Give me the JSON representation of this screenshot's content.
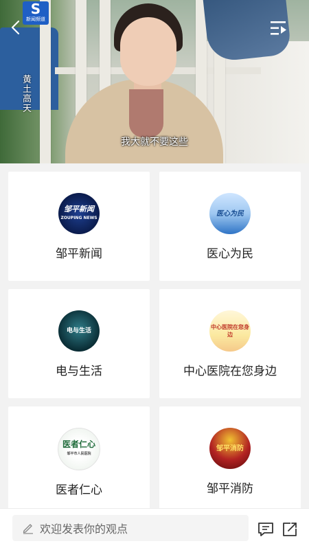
{
  "video": {
    "logo_letter": "S",
    "logo_caption": "新闻频道",
    "show_watermark": "黄土高天",
    "subtitle": "我大就不要这些"
  },
  "cards": [
    {
      "title": "邹平新闻",
      "avatar_text": "邹平新闻",
      "avatar_sub": "ZOUPING NEWS"
    },
    {
      "title": "医心为民",
      "avatar_text": "医心为民",
      "avatar_sub": ""
    },
    {
      "title": "电与生活",
      "avatar_text": "电与生活",
      "avatar_sub": ""
    },
    {
      "title": "中心医院在您身边",
      "avatar_text": "中心医院在您身边",
      "avatar_sub": ""
    },
    {
      "title": "医者仁心",
      "avatar_text": "医者仁心",
      "avatar_sub": "邹平市人民医院"
    },
    {
      "title": "邹平消防",
      "avatar_text": "邹平消防",
      "avatar_sub": ""
    }
  ],
  "bottom_bar": {
    "comment_placeholder": "欢迎发表你的观点",
    "icons": [
      "pencil-icon",
      "comment-icon",
      "share-icon"
    ]
  },
  "colors": {
    "logo_blue": "#1f5fc5",
    "page_bg": "#f2f2f2",
    "card_bg": "#ffffff"
  }
}
